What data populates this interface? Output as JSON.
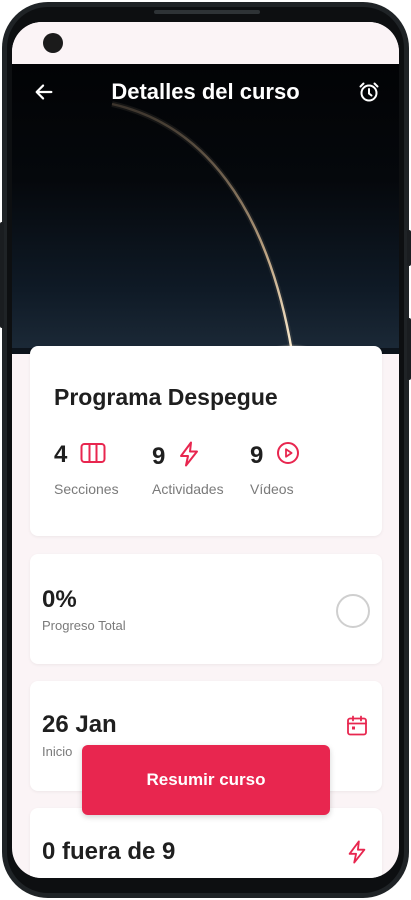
{
  "appbar": {
    "title": "Detalles del curso",
    "back_icon": "arrow-left-icon",
    "alarm_icon": "alarm-clock-icon"
  },
  "course": {
    "title": "Programa Despegue",
    "stats": [
      {
        "value": "4",
        "label": "Secciones",
        "icon": "sections-icon"
      },
      {
        "value": "9",
        "label": "Actividades",
        "icon": "bolt-icon"
      },
      {
        "value": "9",
        "label": "Vídeos",
        "icon": "play-circle-icon"
      }
    ]
  },
  "progress": {
    "value": "0%",
    "label": "Progreso Total",
    "fraction": 0
  },
  "start": {
    "value": "26 Jan",
    "label": "Inicio"
  },
  "activities": {
    "value": "0 fuera de 9"
  },
  "cta": {
    "label": "Resumir curso"
  },
  "colors": {
    "accent": "#e8264f",
    "muted": "#7a7a7a",
    "screen_bg": "#fbf4f6"
  }
}
